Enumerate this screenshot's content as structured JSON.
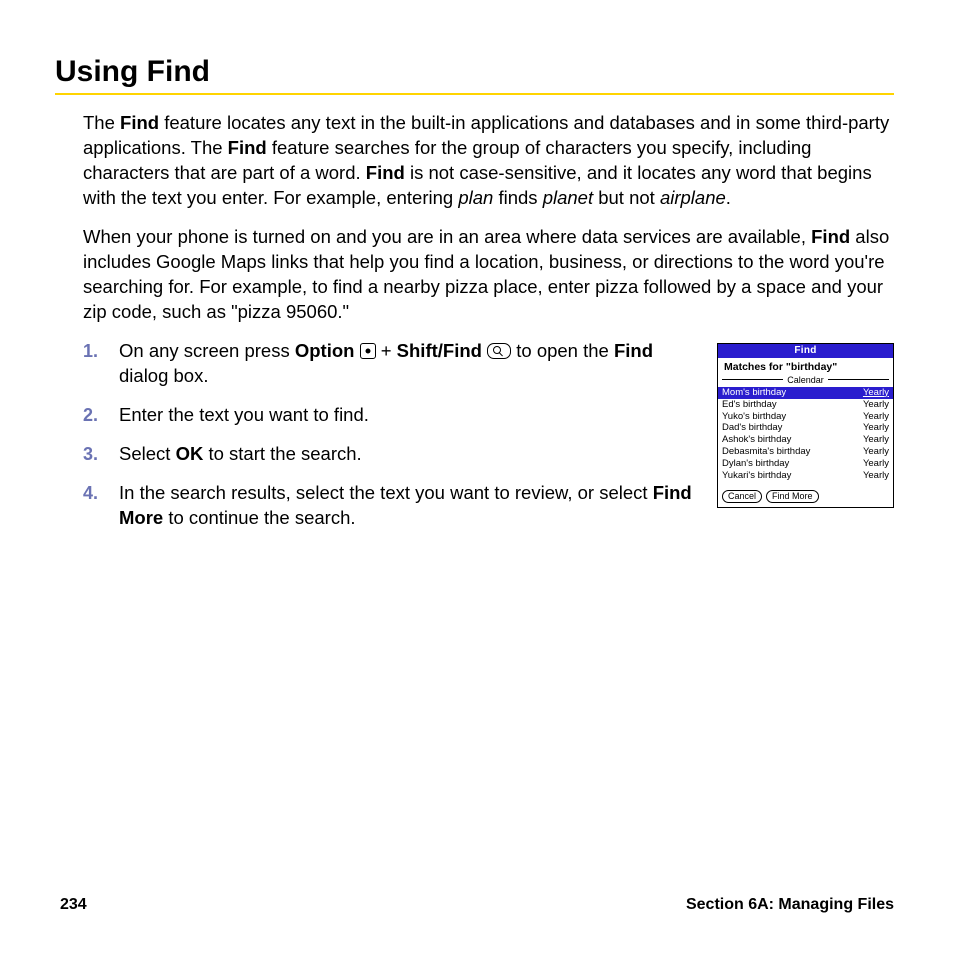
{
  "heading": "Using Find",
  "para1": {
    "t1": "The ",
    "b1": "Find",
    "t2": " feature locates any text in the built-in applications and databases and in some third-party applications. The ",
    "b2": "Find",
    "t3": " feature searches for the group of characters you specify, including characters that are part of a word. ",
    "b3": "Find",
    "t4": " is not case-sensitive, and it locates any word that begins with the text you enter. For example, entering ",
    "i1": "plan",
    "t5": " finds ",
    "i2": "planet",
    "t6": " but not ",
    "i3": "airplane",
    "t7": "."
  },
  "para2": {
    "t1": "When your phone is turned on and you are in an area where data services are available, ",
    "b1": "Find",
    "t2": " also includes Google Maps links that help you find a location, business, or directions to the word you're searching for. For example, to find a nearby pizza place, enter pizza followed by a space and your zip code, such as \"pizza 95060.\""
  },
  "steps": {
    "s1": {
      "t1": "On any screen press ",
      "b1": "Option",
      "t2": " + ",
      "b2": "Shift/Find",
      "t3": " to open the ",
      "b3": "Find",
      "t4": " dialog box."
    },
    "s2": {
      "t1": "Enter the text you want to find."
    },
    "s3": {
      "t1": "Select ",
      "b1": "OK",
      "t2": " to start the search."
    },
    "s4": {
      "t1": "In the search results, select the text you want to review, or select ",
      "b1": "Find More",
      "t2": " to continue the search."
    }
  },
  "screenshot": {
    "title": "Find",
    "subtitle": "Matches for \"birthday\"",
    "group": "Calendar",
    "rows": [
      {
        "left": "Mom's birthday",
        "right": "Yearly",
        "sel": true
      },
      {
        "left": "Ed's birthday",
        "right": "Yearly"
      },
      {
        "left": "Yuko's birthday",
        "right": "Yearly"
      },
      {
        "left": "Dad's birthday",
        "right": "Yearly"
      },
      {
        "left": "Ashok's birthday",
        "right": "Yearly"
      },
      {
        "left": "Debasmita's birthday",
        "right": "Yearly"
      },
      {
        "left": "Dylan's birthday",
        "right": "Yearly"
      },
      {
        "left": "Yukari's birthday",
        "right": "Yearly"
      }
    ],
    "buttons": {
      "cancel": "Cancel",
      "findmore": "Find More"
    }
  },
  "footer": {
    "page": "234",
    "section": "Section 6A: Managing Files"
  }
}
